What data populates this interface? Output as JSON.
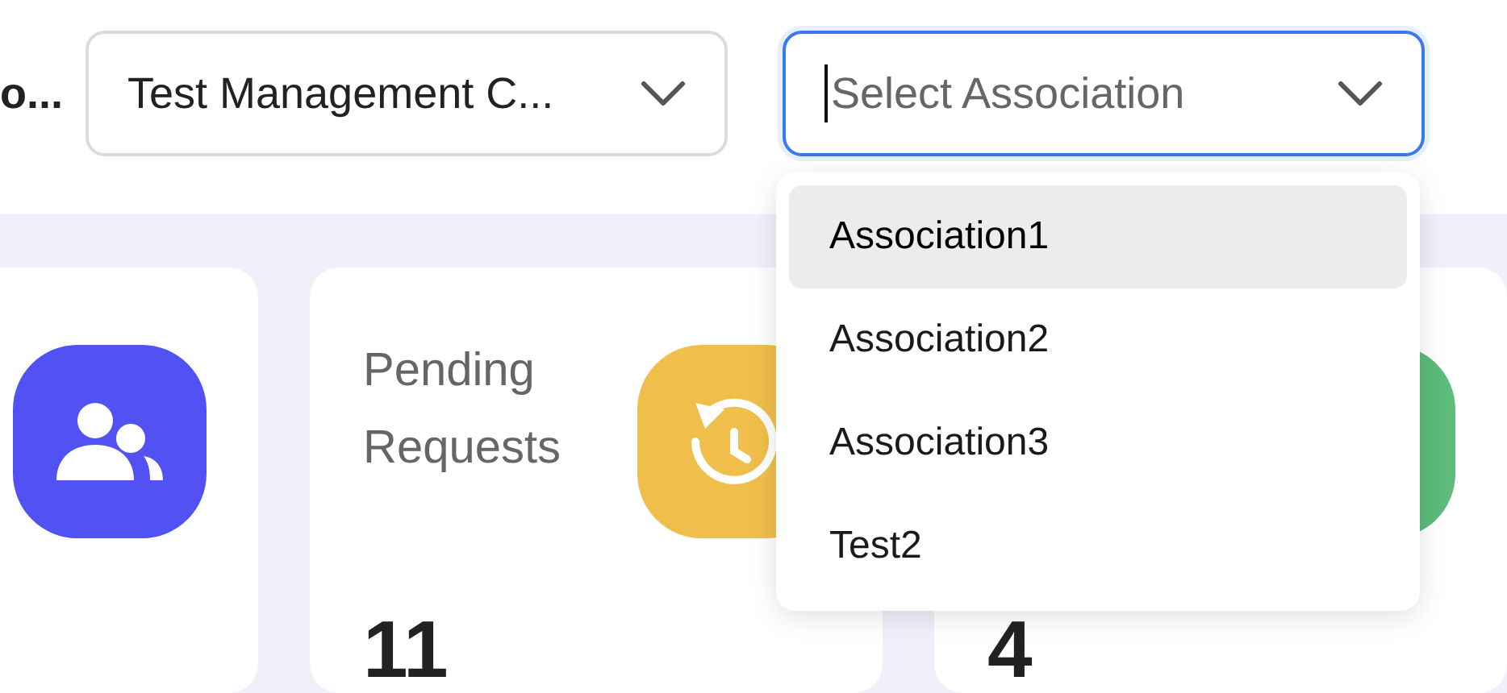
{
  "header": {
    "label": "o...",
    "selects": [
      {
        "value": "Test Management C...",
        "focused": false
      },
      {
        "placeholder": "Select Association",
        "focused": true,
        "options": [
          {
            "label": "Association1",
            "selected": true
          },
          {
            "label": "Association2",
            "selected": false
          },
          {
            "label": "Association3",
            "selected": false
          },
          {
            "label": "Test2",
            "selected": false
          }
        ]
      }
    ]
  },
  "cards": [
    {
      "kind": "members",
      "color": "#5151f4"
    },
    {
      "kind": "pending",
      "title": "Pending Requests",
      "value": "11",
      "color": "#f0be4b"
    },
    {
      "value": "4",
      "color": "#5dbb7b"
    }
  ]
}
